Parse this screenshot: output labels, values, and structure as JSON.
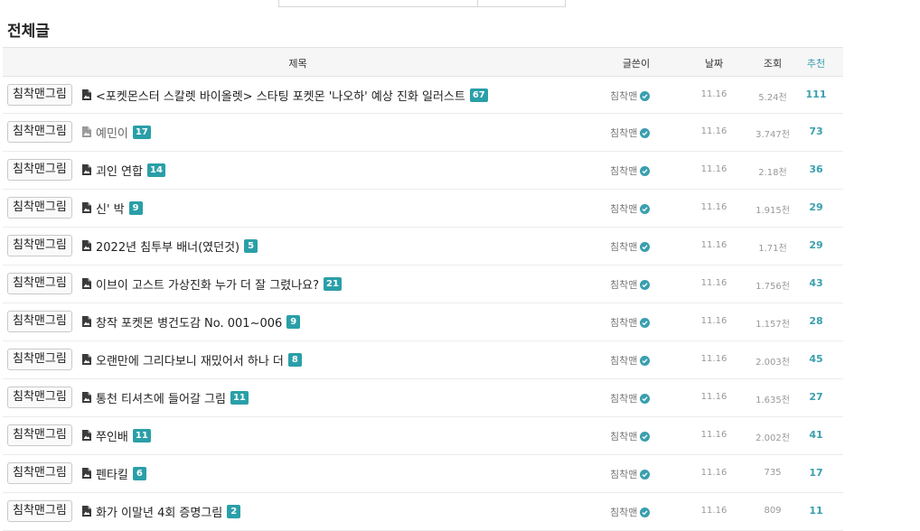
{
  "section_title": "전체글",
  "columns": {
    "title": "제목",
    "writer": "글쓴이",
    "date": "날짜",
    "views": "조회",
    "recommend": "추천"
  },
  "colors": {
    "accent": "#2a9fa8",
    "badge": "#3a9fae"
  },
  "rows": [
    {
      "category": "침착맨그림",
      "title": "<포켓몬스터 스칼렛 바이올렛> 스타팅 포켓몬 '나오하' 예상 진화 일러스트",
      "comments": "67",
      "writer": "침착맨",
      "date": "11.16",
      "views": "5.24천",
      "recommend": "111",
      "dim": false
    },
    {
      "category": "침착맨그림",
      "title": "예민이",
      "comments": "17",
      "writer": "침착맨",
      "date": "11.16",
      "views": "3.747천",
      "recommend": "73",
      "dim": true
    },
    {
      "category": "침착맨그림",
      "title": "괴인 연합",
      "comments": "14",
      "writer": "침착맨",
      "date": "11.16",
      "views": "2.18천",
      "recommend": "36",
      "dim": false
    },
    {
      "category": "침착맨그림",
      "title": "신' 박",
      "comments": "9",
      "writer": "침착맨",
      "date": "11.16",
      "views": "1.915천",
      "recommend": "29",
      "dim": false
    },
    {
      "category": "침착맨그림",
      "title": "2022년 침투부 배너(였던것)",
      "comments": "5",
      "writer": "침착맨",
      "date": "11.16",
      "views": "1.71천",
      "recommend": "29",
      "dim": false
    },
    {
      "category": "침착맨그림",
      "title": "이브이 고스트 가상진화 누가 더 잘 그렸나요?",
      "comments": "21",
      "writer": "침착맨",
      "date": "11.16",
      "views": "1.756천",
      "recommend": "43",
      "dim": false
    },
    {
      "category": "침착맨그림",
      "title": "창작 포켓몬 병건도감 No. 001~006",
      "comments": "9",
      "writer": "침착맨",
      "date": "11.16",
      "views": "1.157천",
      "recommend": "28",
      "dim": false
    },
    {
      "category": "침착맨그림",
      "title": "오랜만에 그리다보니 재밌어서 하나 더",
      "comments": "8",
      "writer": "침착맨",
      "date": "11.16",
      "views": "2.003천",
      "recommend": "45",
      "dim": false
    },
    {
      "category": "침착맨그림",
      "title": "통천 티셔츠에 들어갈 그림",
      "comments": "11",
      "writer": "침착맨",
      "date": "11.16",
      "views": "1.635천",
      "recommend": "27",
      "dim": false
    },
    {
      "category": "침착맨그림",
      "title": "쭈인배",
      "comments": "11",
      "writer": "침착맨",
      "date": "11.16",
      "views": "2.002천",
      "recommend": "41",
      "dim": false
    },
    {
      "category": "침착맨그림",
      "title": "펜타킬",
      "comments": "6",
      "writer": "침착맨",
      "date": "11.16",
      "views": "735",
      "recommend": "17",
      "dim": false
    },
    {
      "category": "침착맨그림",
      "title": "화가 이말년 4회 증명그림",
      "comments": "2",
      "writer": "침착맨",
      "date": "11.16",
      "views": "809",
      "recommend": "11",
      "dim": false
    }
  ]
}
